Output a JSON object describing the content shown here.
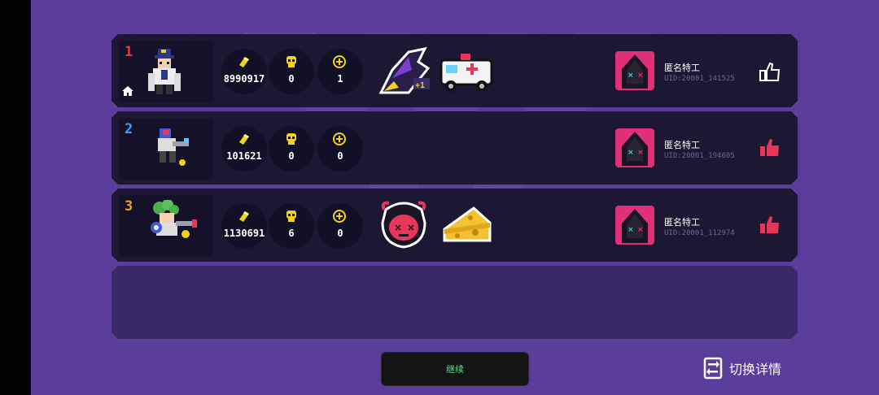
{
  "rows": [
    {
      "rank": "1",
      "rank_color": "#e83a3a",
      "gold": "8990917",
      "kills": "0",
      "revives": "1",
      "items": [
        "wizard-hat-plus-one-icon",
        "ambulance-icon"
      ],
      "player_name": "匿名特工",
      "uid": "UID:20001_141525",
      "liked": false
    },
    {
      "rank": "2",
      "rank_color": "#3aa0ff",
      "gold": "101621",
      "kills": "0",
      "revives": "0",
      "items": [],
      "player_name": "匿名特工",
      "uid": "UID:20001_194605",
      "liked": true
    },
    {
      "rank": "3",
      "rank_color": "#f0a020",
      "gold": "1130691",
      "kills": "6",
      "revives": "0",
      "items": [
        "angry-devil-face-icon",
        "cheese-icon"
      ],
      "player_name": "匿名特工",
      "uid": "UID:20001_112974",
      "liked": true
    }
  ],
  "continue_label": "继续",
  "switch_label": "切换详情",
  "colors": {
    "like_active": "#e8365a",
    "like_idle": "#ffffff",
    "gold_icon": "#f2d21a",
    "kill_icon": "#f2d21a",
    "revive_icon": "#f2d21a"
  }
}
